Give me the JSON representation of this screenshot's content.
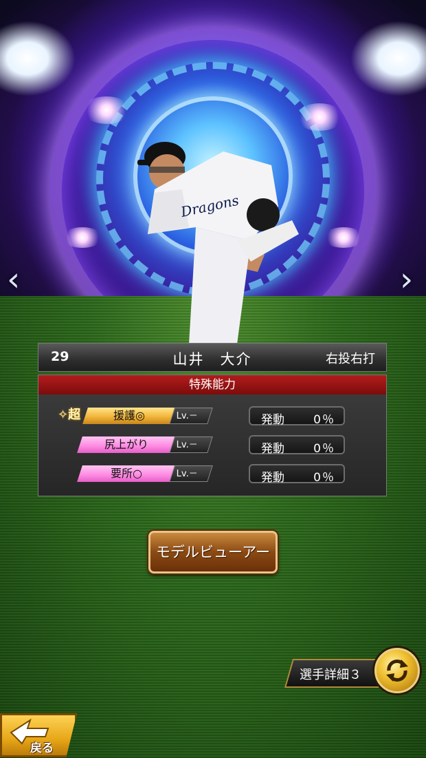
{
  "player": {
    "number": "29",
    "name": "山井　大介",
    "throws_bats": "右投右打"
  },
  "abilities_panel": {
    "title": "特殊能力",
    "items": [
      {
        "super_mark": "✧超",
        "name": "援護◎",
        "level": "Lv.－",
        "activation_label": "発動",
        "activation_pct": "0％",
        "tier": "gold"
      },
      {
        "name": "尻上がり",
        "level": "Lv.－",
        "activation_label": "発動",
        "activation_pct": "0％",
        "tier": "pink"
      },
      {
        "name": "要所○",
        "level": "Lv.－",
        "activation_label": "発動",
        "activation_pct": "0％",
        "tier": "pink"
      }
    ]
  },
  "nav": {
    "prev_arrow": "‹",
    "next_arrow": "›"
  },
  "buttons": {
    "model_viewer": "モデルビューアー",
    "player_detail": "選手詳細３",
    "back": "戻る"
  },
  "colors": {
    "panel_header_red": "#9a1414",
    "gold_badge": "#f2b53a",
    "pink_badge": "#ff8ee3",
    "button_brown": "#8b4a14"
  }
}
